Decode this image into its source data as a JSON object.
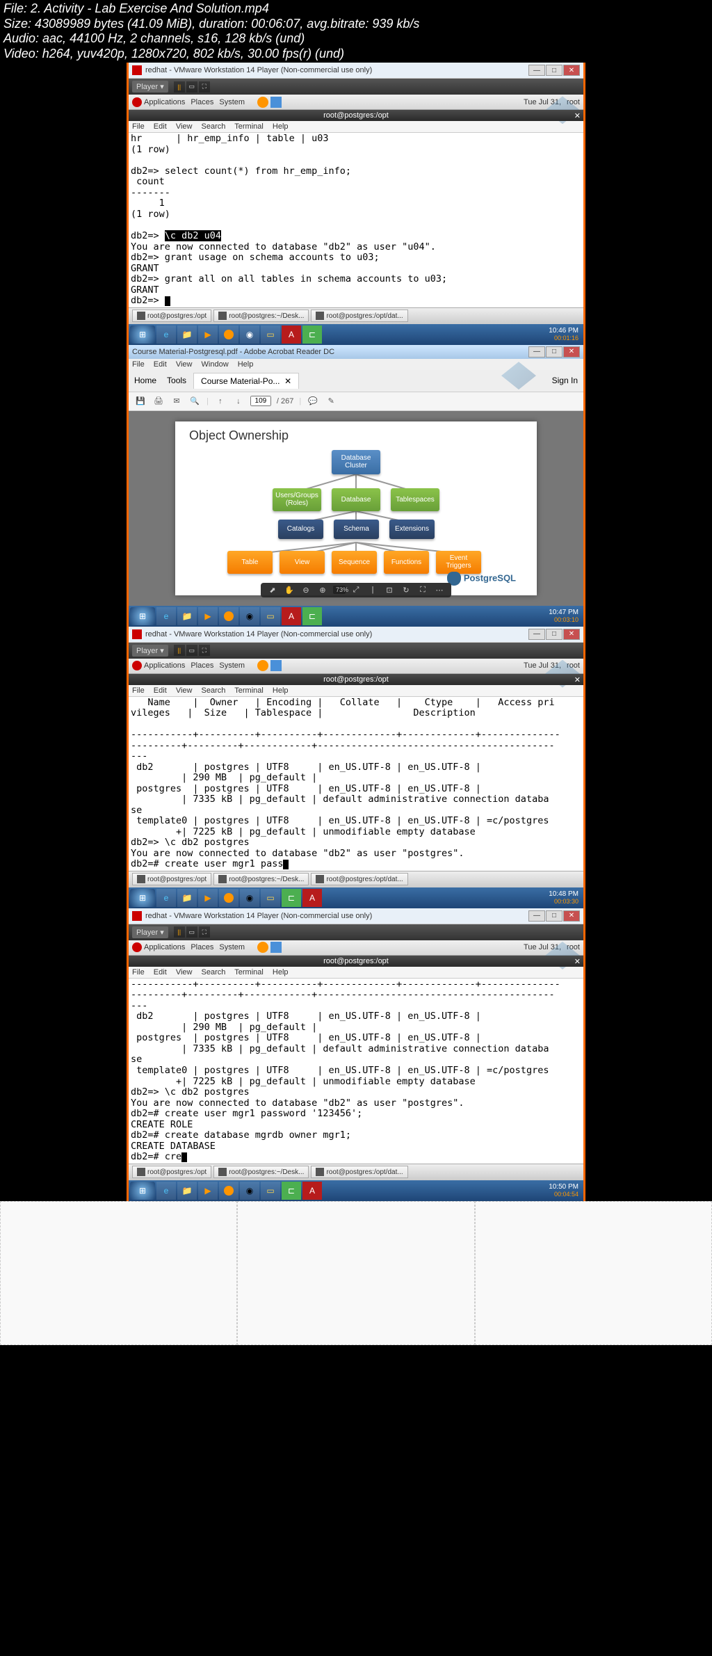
{
  "header": {
    "file": "File: 2. Activity - Lab Exercise And Solution.mp4",
    "size": "Size: 43089989 bytes (41.09 MiB), duration: 00:06:07, avg.bitrate: 939 kb/s",
    "audio": "Audio: aac, 44100 Hz, 2 channels, s16, 128 kb/s (und)",
    "video": "Video: h264, yuv420p, 1280x720, 802 kb/s, 30.00 fps(r) (und)"
  },
  "vmware": {
    "title": "redhat - VMware Workstation 14 Player (Non-commercial use only)",
    "player_label": "Player ▾"
  },
  "gnome": {
    "apps": "Applications",
    "places": "Places",
    "system": "System",
    "date": "Tue Jul 31,",
    "user": "root"
  },
  "terminal": {
    "title": "root@postgres:/opt",
    "menu": {
      "file": "File",
      "edit": "Edit",
      "view": "View",
      "search": "Search",
      "term": "Terminal",
      "help": "Help"
    }
  },
  "term1_content": "hr      | hr_emp_info | table | u03\n(1 row)\n\ndb2=> select count(*) from hr_emp_info;\n count\n-------\n     1\n(1 row)\n\ndb2=> ",
  "term1_hl": "\\c db2 u04",
  "term1_after": "\nYou are now connected to database \"db2\" as user \"u04\".\ndb2=> grant usage on schema accounts to u03;\nGRANT\ndb2=> grant all on all tables in schema accounts to u03;\nGRANT\ndb2=> ",
  "tasks": {
    "t1": "root@postgres:/opt",
    "t2": "root@postgres:~/Desk...",
    "t3": "root@postgres:/opt/dat..."
  },
  "adobe": {
    "title": "Course Material-Postgresql.pdf - Adobe Acrobat Reader DC",
    "menu": {
      "file": "File",
      "edit": "Edit",
      "view": "View",
      "window": "Window",
      "help": "Help"
    },
    "home": "Home",
    "tools": "Tools",
    "tab": "Course Material-Po...",
    "signin": "Sign In",
    "page_num": "109",
    "page_total": "/ 267",
    "zoom": "73%"
  },
  "pdf": {
    "title": "Object Ownership",
    "cluster": "Database Cluster",
    "users": "Users/Groups (Roles)",
    "database": "Database",
    "tablespaces": "Tablespaces",
    "catalogs": "Catalogs",
    "schema": "Schema",
    "extensions": "Extensions",
    "table": "Table",
    "view": "View",
    "sequence": "Sequence",
    "functions": "Functions",
    "triggers": "Event Triggers",
    "pg": "PostgreSQL"
  },
  "term3_content": "   Name    |  Owner   | Encoding |   Collate   |    Ctype    |   Access pri\nvileges   |  Size   | Tablespace |                Description\n\n-----------+----------+----------+-------------+-------------+--------------\n---------+---------+------------+------------------------------------------\n---\n db2       | postgres | UTF8     | en_US.UTF-8 | en_US.UTF-8 |\n         | 290 MB  | pg_default |\n postgres  | postgres | UTF8     | en_US.UTF-8 | en_US.UTF-8 |\n         | 7335 kB | pg_default | default administrative connection databa\nse\n template0 | postgres | UTF8     | en_US.UTF-8 | en_US.UTF-8 | =c/postgres\n        +| 7225 kB | pg_default | unmodifiable empty database\ndb2=> \\c db2 postgres\nYou are now connected to database \"db2\" as user \"postgres\".\ndb2=# create user mgr1 pass",
  "term4_content": "-----------+----------+----------+-------------+-------------+--------------\n---------+---------+------------+------------------------------------------\n---\n db2       | postgres | UTF8     | en_US.UTF-8 | en_US.UTF-8 |\n         | 290 MB  | pg_default |\n postgres  | postgres | UTF8     | en_US.UTF-8 | en_US.UTF-8 |\n         | 7335 kB | pg_default | default administrative connection databa\nse\n template0 | postgres | UTF8     | en_US.UTF-8 | en_US.UTF-8 | =c/postgres\n        +| 7225 kB | pg_default | unmodifiable empty database\ndb2=> \\c db2 postgres\nYou are now connected to database \"db2\" as user \"postgres\".\ndb2=# create user mgr1 password '123456';\nCREATE ROLE\ndb2=# create database mgrdb owner mgr1;\nCREATE DATABASE\ndb2=# cre",
  "wintime": {
    "t1": "10:46 PM",
    "ts1": "00:01:16",
    "t2": "10:47 PM",
    "ts2": "00:03:10",
    "t3": "10:48 PM",
    "ts3": "00:03:30",
    "t4": "10:50 PM",
    "ts4": "00:04:54"
  },
  "chart_data": {
    "type": "diagram",
    "title": "Object Ownership",
    "hierarchy": {
      "root": "Database Cluster",
      "level2": [
        "Users/Groups (Roles)",
        "Database",
        "Tablespaces"
      ],
      "level3": [
        "Catalogs",
        "Schema",
        "Extensions"
      ],
      "level4": [
        "Table",
        "View",
        "Sequence",
        "Functions",
        "Event Triggers"
      ]
    }
  }
}
